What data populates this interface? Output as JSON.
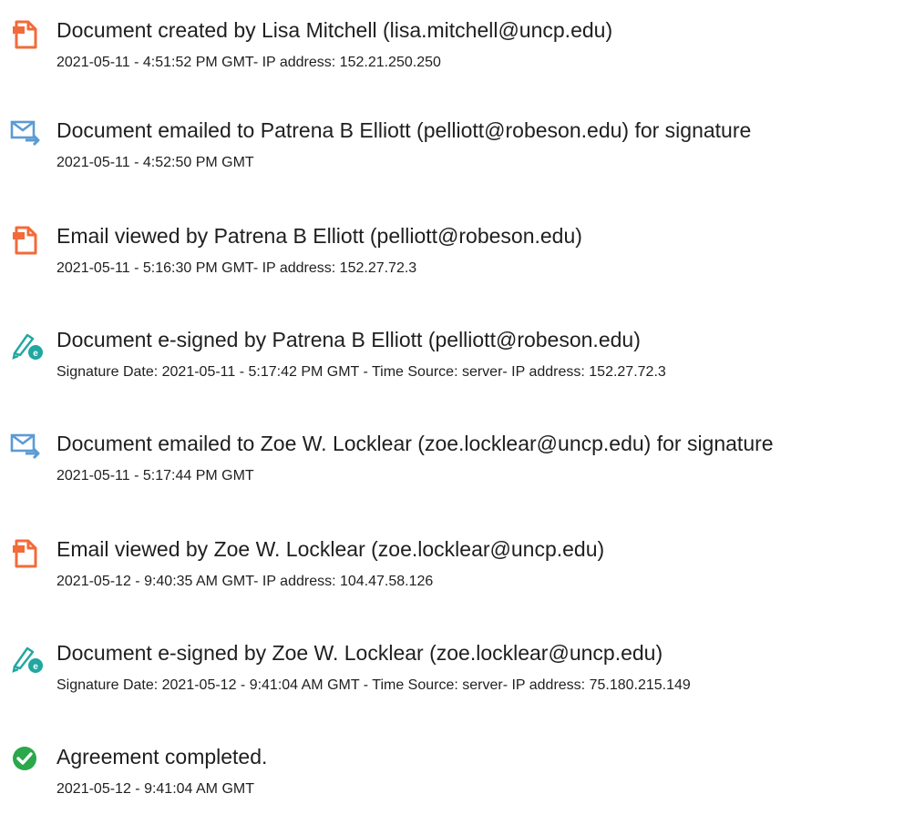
{
  "colors": {
    "doc_icon": "#F26B3A",
    "email_icon": "#5B9BD5",
    "sign_icon": "#20A7A0",
    "complete_icon": "#2AA84A"
  },
  "events": [
    {
      "icon": "document-icon",
      "title": "Document created by Lisa Mitchell (lisa.mitchell@uncp.edu)",
      "meta": "2021-05-11 - 4:51:52 PM GMT- IP address: 152.21.250.250"
    },
    {
      "icon": "email-sent-icon",
      "title": "Document emailed to Patrena B Elliott (pelliott@robeson.edu) for signature",
      "meta": "2021-05-11 - 4:52:50 PM GMT"
    },
    {
      "icon": "document-icon",
      "title": "Email viewed by Patrena B Elliott (pelliott@robeson.edu)",
      "meta": "2021-05-11 - 5:16:30 PM GMT- IP address: 152.27.72.3"
    },
    {
      "icon": "esign-pen-icon",
      "title": "Document e-signed by Patrena B Elliott (pelliott@robeson.edu)",
      "meta": "Signature Date: 2021-05-11 - 5:17:42 PM GMT - Time Source: server- IP address: 152.27.72.3"
    },
    {
      "icon": "email-sent-icon",
      "title": "Document emailed to Zoe W. Locklear (zoe.locklear@uncp.edu) for signature",
      "meta": "2021-05-11 - 5:17:44 PM GMT"
    },
    {
      "icon": "document-icon",
      "title": "Email viewed by Zoe W. Locklear (zoe.locklear@uncp.edu)",
      "meta": "2021-05-12 - 9:40:35 AM GMT- IP address: 104.47.58.126"
    },
    {
      "icon": "esign-pen-icon",
      "title": "Document e-signed by Zoe W. Locklear (zoe.locklear@uncp.edu)",
      "meta": "Signature Date: 2021-05-12 - 9:41:04 AM GMT - Time Source: server- IP address: 75.180.215.149"
    },
    {
      "icon": "check-circle-icon",
      "title": "Agreement completed.",
      "meta": "2021-05-12 - 9:41:04 AM GMT"
    }
  ]
}
